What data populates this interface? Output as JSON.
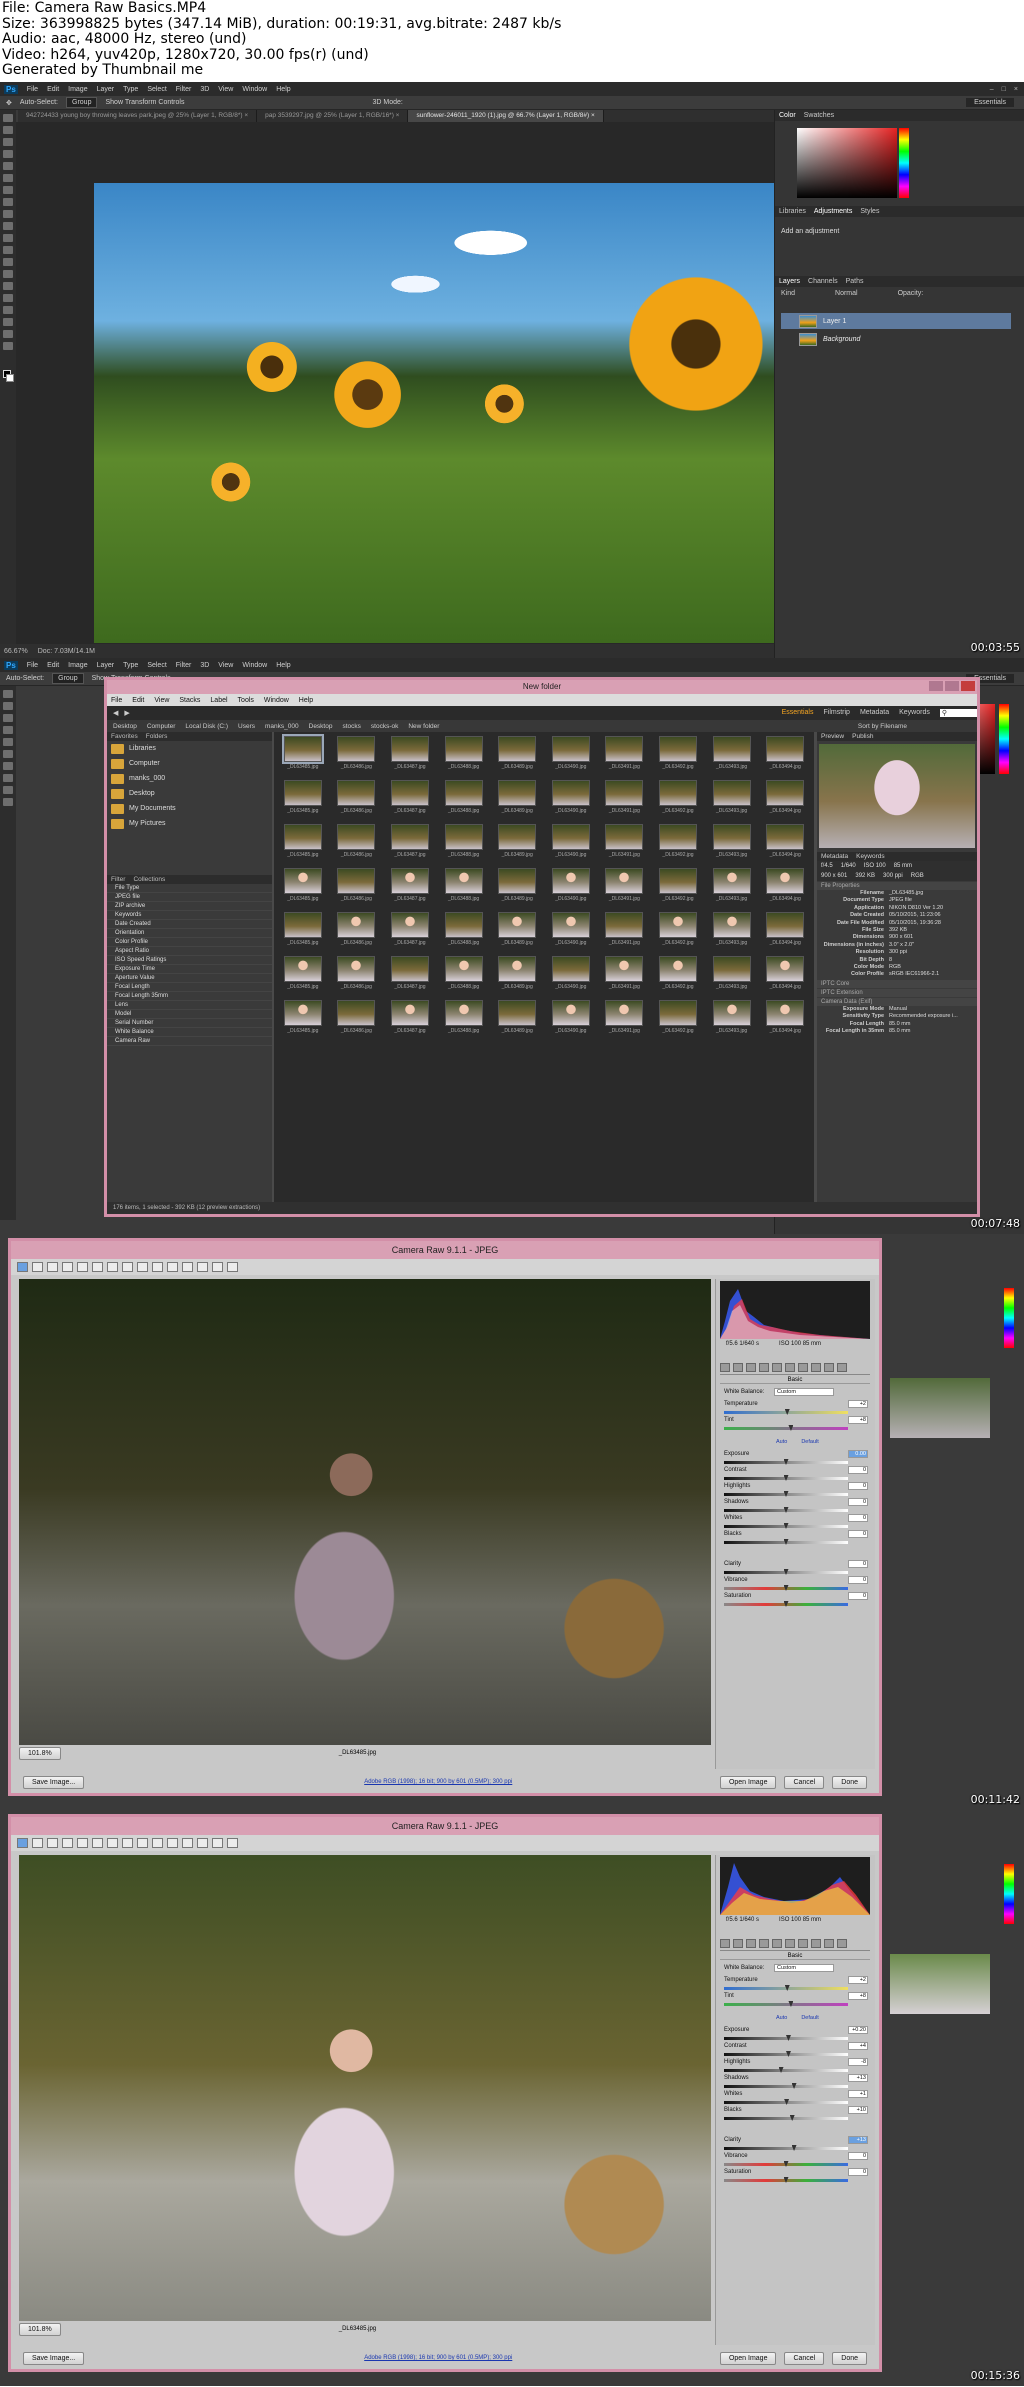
{
  "header": {
    "line1": "File: Camera Raw Basics.MP4",
    "line2": "Size: 363998825 bytes (347.14 MiB), duration: 00:19:31, avg.bitrate: 2487 kb/s",
    "line3": "Audio: aac, 48000 Hz, stereo (und)",
    "line4": "Video: h264, yuv420p, 1280x720, 30.00 fps(r) (und)",
    "line5": "Generated by Thumbnail me"
  },
  "photoshop": {
    "logo": "Ps",
    "menu": [
      "File",
      "Edit",
      "Image",
      "Layer",
      "Type",
      "Select",
      "Filter",
      "3D",
      "View",
      "Window",
      "Help"
    ],
    "options": {
      "auto_select": "Auto-Select:",
      "group": "Group",
      "transform": "Show Transform Controls",
      "mode3d": "3D Mode:",
      "workspace": "Essentials"
    },
    "tabs": [
      "942724433 young boy throwing leaves park.jpeg @ 25% (Layer 1, RGB/8*) ×",
      "pap 3539297.jpg @ 25% (Layer 1, RGB/16*) ×",
      "sunflower-246011_1920 (1).jpg @ 66.7% (Layer 1, RGB/8#) ×"
    ],
    "status_zoom": "66.67%",
    "status_doc": "Doc: 7.03M/14.1M",
    "panel_tabs_top": [
      "Color",
      "Swatches"
    ],
    "panel_tabs_mid": [
      "Libraries",
      "Adjustments",
      "Styles"
    ],
    "adjust_hint": "Add an adjustment",
    "panel_tabs_layers": [
      "Layers",
      "Channels",
      "Paths"
    ],
    "layer_kind": "Kind",
    "blend_mode": "Normal",
    "opacity_label": "Opacity:",
    "layers": [
      "Layer 1",
      "Background"
    ]
  },
  "bridge": {
    "title": "New folder",
    "menu": [
      "File",
      "Edit",
      "View",
      "Stacks",
      "Label",
      "Tools",
      "Window",
      "Help"
    ],
    "workspaces": [
      "Essentials",
      "Filmstrip",
      "Metadata",
      "Keywords"
    ],
    "path": [
      "Desktop",
      "Computer",
      "Local Disk (C:)",
      "Users",
      "manks_000",
      "Desktop",
      "stocks",
      "stocks-ok",
      "New folder"
    ],
    "sort": "Sort by Filename",
    "left_tabs": [
      "Favorites",
      "Folders"
    ],
    "favorites": [
      "Libraries",
      "Computer",
      "manks_000",
      "Desktop",
      "My Documents",
      "My Pictures"
    ],
    "filter_tabs": [
      "Filter",
      "Collections"
    ],
    "filters": [
      "File Type",
      "JPEG file",
      "ZIP archive",
      "Keywords",
      "Date Created",
      "Orientation",
      "Color Profile",
      "Aspect Ratio",
      "ISO Speed Ratings",
      "Exposure Time",
      "Aperture Value",
      "Focal Length",
      "Focal Length 35mm",
      "Lens",
      "Model",
      "Serial Number",
      "White Balance",
      "Camera Raw"
    ],
    "thumb_names": [
      "_DL63485.jpg",
      "_DL63486.jpg",
      "_DL63487.jpg",
      "_DL63488.jpg",
      "_DL63489.jpg",
      "_DL63490.jpg",
      "_DL63491.jpg",
      "_DL63492.jpg",
      "_DL63493.jpg",
      "_DL63494.jpg"
    ],
    "right_tabs": [
      "Preview",
      "Publish"
    ],
    "meta_tabs": [
      "Metadata",
      "Keywords"
    ],
    "exif_quick": {
      "aperture": "f/4.5",
      "shutter": "1/640",
      "iso": "ISO 100",
      "focal": "85 mm",
      "dims": "900 x 601",
      "size": "392 KB",
      "res": "300 ppi",
      "mode": "RGB"
    },
    "file_props_head": "File Properties",
    "file_props": [
      {
        "k": "Filename",
        "v": "_DL63485.jpg"
      },
      {
        "k": "Document Type",
        "v": "JPEG file"
      },
      {
        "k": "Application",
        "v": "NIKON D810 Ver 1.20"
      },
      {
        "k": "Date Created",
        "v": "05/10/2015, 11:23:06"
      },
      {
        "k": "Date File Modified",
        "v": "05/10/2015, 19:36:28"
      },
      {
        "k": "File Size",
        "v": "392 KB"
      },
      {
        "k": "Dimensions",
        "v": "900 x 601"
      },
      {
        "k": "Dimensions (in inches)",
        "v": "3.0\" x 2.0\""
      },
      {
        "k": "Resolution",
        "v": "300 ppi"
      },
      {
        "k": "Bit Depth",
        "v": "8"
      },
      {
        "k": "Color Mode",
        "v": "RGB"
      },
      {
        "k": "Color Profile",
        "v": "sRGB IEC61966-2.1"
      }
    ],
    "iptc_head": "IPTC Core",
    "iptc_ext_head": "IPTC Extension",
    "camera_head": "Camera Data (Exif)",
    "camera_rows": [
      {
        "k": "Exposure Mode",
        "v": "Manual"
      },
      {
        "k": "Sensitivity Type",
        "v": "Recommended exposure i..."
      },
      {
        "k": "Focal Length",
        "v": "85.0 mm"
      },
      {
        "k": "Focal Length in 35mm",
        "v": "85.0 mm"
      }
    ],
    "status": "176 items, 1 selected - 392 KB (12 preview extractions)"
  },
  "acr1": {
    "title": "Camera Raw 9.1.1  -  JPEG",
    "exif_left": "f/5.6   1/640 s",
    "exif_right": "ISO 100   85 mm",
    "basic_label": "Basic",
    "white_balance_label": "White Balance:",
    "white_balance_value": "Custom",
    "auto": "Auto",
    "default": "Default",
    "params": [
      {
        "label": "Temperature",
        "value": "+2"
      },
      {
        "label": "Tint",
        "value": "+8"
      },
      {
        "label": "Exposure",
        "value": "0.00"
      },
      {
        "label": "Contrast",
        "value": "0"
      },
      {
        "label": "Highlights",
        "value": "0"
      },
      {
        "label": "Shadows",
        "value": "0"
      },
      {
        "label": "Whites",
        "value": "0"
      },
      {
        "label": "Blacks",
        "value": "0"
      },
      {
        "label": "Clarity",
        "value": "0"
      },
      {
        "label": "Vibrance",
        "value": "0"
      },
      {
        "label": "Saturation",
        "value": "0"
      }
    ],
    "zoom": "101.8%",
    "filename": "_DL63485.jpg",
    "save": "Save Image...",
    "workflow": "Adobe RGB (1998); 16 bit; 900 by 601 (0.5MP); 300 ppi",
    "open": "Open Image",
    "cancel": "Cancel",
    "done": "Done"
  },
  "acr2": {
    "title": "Camera Raw 9.1.1  -  JPEG",
    "exif_left": "f/5.6   1/640 s",
    "exif_right": "ISO 100   85 mm",
    "basic_label": "Basic",
    "white_balance_label": "White Balance:",
    "white_balance_value": "Custom",
    "auto": "Auto",
    "default": "Default",
    "params": [
      {
        "label": "Temperature",
        "value": "+2"
      },
      {
        "label": "Tint",
        "value": "+8"
      },
      {
        "label": "Exposure",
        "value": "+0.20"
      },
      {
        "label": "Contrast",
        "value": "+4"
      },
      {
        "label": "Highlights",
        "value": "-8"
      },
      {
        "label": "Shadows",
        "value": "+13"
      },
      {
        "label": "Whites",
        "value": "+1"
      },
      {
        "label": "Blacks",
        "value": "+10"
      },
      {
        "label": "Clarity",
        "value": "+13"
      },
      {
        "label": "Vibrance",
        "value": "0"
      },
      {
        "label": "Saturation",
        "value": "0"
      }
    ],
    "zoom": "101.8%",
    "filename": "_DL63485.jpg",
    "save": "Save Image...",
    "workflow": "Adobe RGB (1998); 16 bit; 900 by 601 (0.5MP); 300 ppi",
    "open": "Open Image",
    "cancel": "Cancel",
    "done": "Done"
  },
  "timestamps": [
    "00:03:55",
    "00:07:48",
    "00:11:42",
    "00:15:36"
  ]
}
